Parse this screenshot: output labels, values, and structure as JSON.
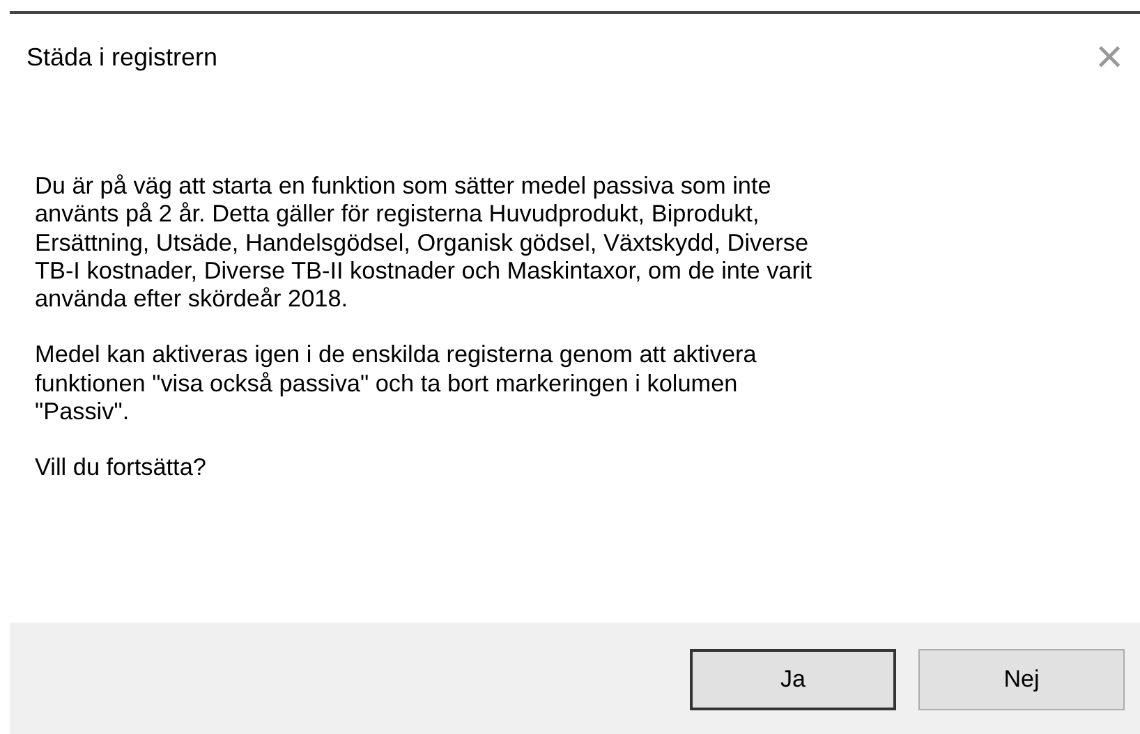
{
  "window": {
    "title": "Städa i registrern",
    "close": "×"
  },
  "message": {
    "paragraphs": [
      [
        "Du är på väg att starta en funktion som sätter medel passiva som inte",
        "använts på 2 år. Detta gäller för registerna Huvudprodukt, Biprodukt,",
        "Ersättning, Utsäde, Handelsgödsel, Organisk gödsel, Växtskydd, Diverse",
        "TB-I kostnader, Diverse TB-II kostnader och Maskintaxor, om de inte varit",
        "använda efter skördeår 2018."
      ],
      [
        "Medel kan aktiveras igen i de enskilda registerna genom att aktivera",
        "funktionen \"visa också passiva\" och ta bort markeringen i kolumen",
        "\"Passiv\"."
      ],
      [
        "Vill du fortsätta?"
      ]
    ]
  },
  "buttons": [
    {
      "label": "Ja",
      "default": true
    },
    {
      "label": "Nej",
      "default": false
    }
  ]
}
